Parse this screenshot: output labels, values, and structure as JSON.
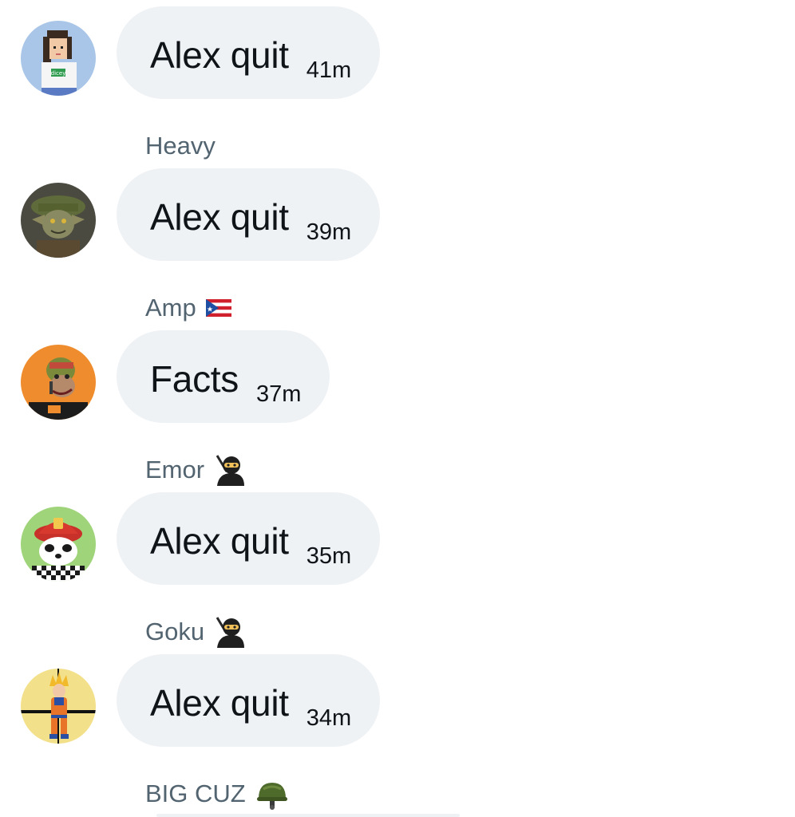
{
  "messages": [
    {
      "sender": "",
      "avatar": "dicey-pixel-girl-avatar",
      "text": "Alex quit",
      "time": "41m",
      "badge": ""
    },
    {
      "sender": "Heavy",
      "avatar": "goblin-soldier-avatar",
      "text": "Alex quit",
      "time": "39m",
      "badge": ""
    },
    {
      "sender": "Amp",
      "avatar": "ape-orange-avatar",
      "text": "Facts",
      "time": "37m",
      "badge": "puerto-rico-flag-icon"
    },
    {
      "sender": "Emor",
      "avatar": "firefighter-panda-avatar",
      "text": "Alex quit",
      "time": "35m",
      "badge": "ninja-icon"
    },
    {
      "sender": "Goku",
      "avatar": "goku-avatar",
      "text": "Alex quit",
      "time": "34m",
      "badge": "ninja-icon"
    },
    {
      "sender": "BIG CUZ",
      "avatar": "",
      "text": "",
      "time": "",
      "badge": "military-helmet-icon"
    }
  ],
  "colors": {
    "bubble": "#eff2f5",
    "sender_text": "#536471",
    "message_text": "#0f1419"
  }
}
